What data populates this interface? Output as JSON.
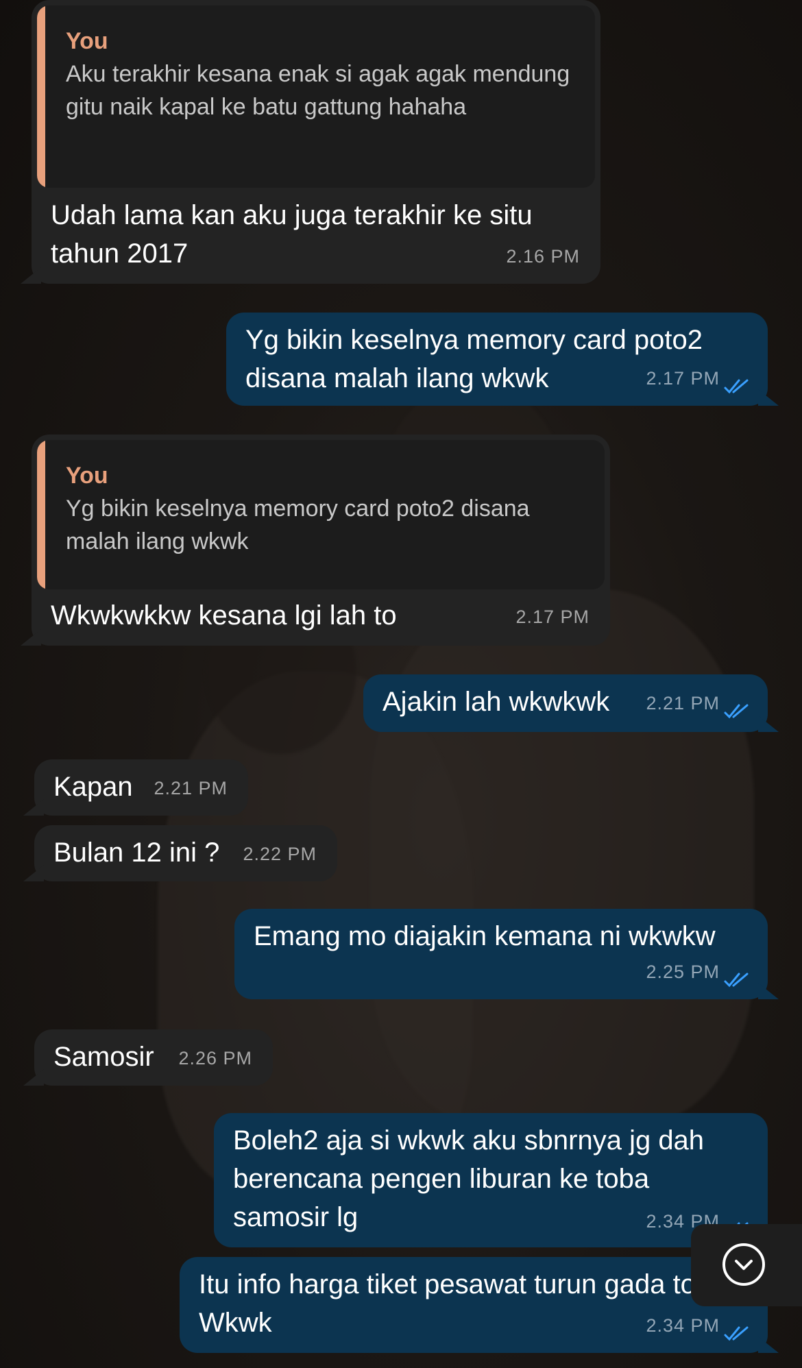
{
  "chat": {
    "messages": [
      {
        "id": "m1",
        "direction": "incoming",
        "quote": {
          "author": "You",
          "text": "Aku terakhir kesana enak si agak agak mendung gitu naik kapal ke batu gattung hahaha"
        },
        "text": "Udah lama kan aku juga terakhir ke situ tahun 2017",
        "time": "2.16 PM"
      },
      {
        "id": "m2",
        "direction": "outgoing",
        "text": "Yg bikin keselnya memory card poto2 disana malah ilang wkwk",
        "time": "2.17 PM",
        "status": "read"
      },
      {
        "id": "m3",
        "direction": "incoming",
        "quote": {
          "author": "You",
          "text": "Yg bikin keselnya memory card poto2 disana malah ilang wkwk"
        },
        "text": "Wkwkwkkw kesana lgi lah to",
        "time": "2.17 PM"
      },
      {
        "id": "m4",
        "direction": "outgoing",
        "text": "Ajakin lah wkwkwk",
        "time": "2.21 PM",
        "status": "read"
      },
      {
        "id": "m5",
        "direction": "incoming",
        "text": "Kapan",
        "time": "2.21 PM"
      },
      {
        "id": "m6",
        "direction": "incoming",
        "text": "Bulan 12 ini ?",
        "time": "2.22 PM"
      },
      {
        "id": "m7",
        "direction": "outgoing",
        "text": "Emang mo diajakin kemana ni wkwkw",
        "time": "2.25 PM",
        "status": "read"
      },
      {
        "id": "m8",
        "direction": "incoming",
        "text": "Samosir",
        "time": "2.26 PM"
      },
      {
        "id": "m9",
        "direction": "outgoing",
        "text": "Boleh2 aja si wkwk aku sbnrnya jg dah berencana pengen liburan ke toba samosir lg",
        "time": "2.34 PM",
        "status": "read"
      },
      {
        "id": "m10",
        "direction": "outgoing",
        "text": "Itu info harga tiket pesawat turun gada to? Wkwk",
        "time": "2.34 PM",
        "status": "read"
      }
    ]
  },
  "colors": {
    "incoming_bubble": "#232323",
    "outgoing_bubble": "#0c3450",
    "quote_accent": "#e8a07c",
    "read_ticks": "#3aa0ff"
  },
  "icons": {
    "read_receipt": "double-check-icon",
    "scroll_down": "chevron-down-icon"
  }
}
